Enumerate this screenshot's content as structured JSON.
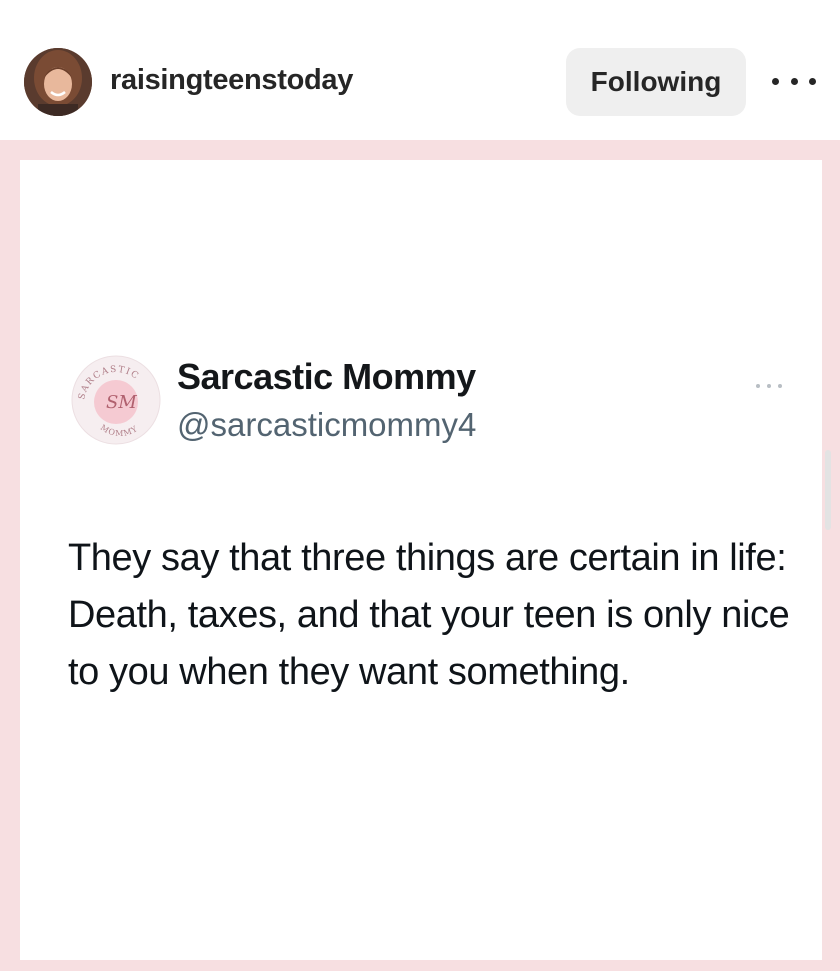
{
  "post_header": {
    "username": "raisingteenstoday",
    "follow_label": "Following",
    "more_icon": "more-horizontal-icon"
  },
  "tweet": {
    "display_name": "Sarcastic Mommy",
    "handle": "@sarcasticmommy4",
    "text": "They say that three things are certain in life: Death, taxes, and that your teen is only nice to you when they want something.",
    "avatar_logo_text": "SARCASTIC MOMMY",
    "avatar_monogram": "SM"
  },
  "colors": {
    "frame_pink": "#f7dfe1",
    "button_bg": "#efefef",
    "name_text": "#14171a",
    "handle_text": "#536471"
  }
}
